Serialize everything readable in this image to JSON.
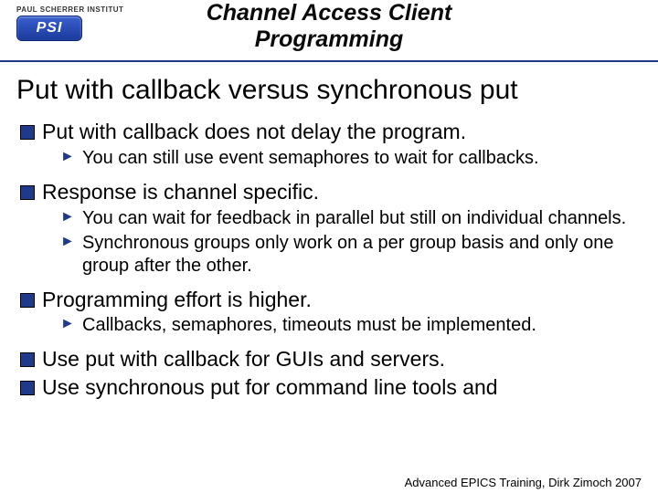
{
  "header": {
    "institute": "PAUL SCHERRER INSTITUT",
    "logo_text": "PSI",
    "title_line1": "Channel Access Client",
    "title_line2": "Programming"
  },
  "slide": {
    "title": "Put with callback versus synchronous put",
    "bullets": [
      {
        "text": "Put with callback does not delay the program.",
        "sub": [
          "You can still use event semaphores to wait for callbacks."
        ]
      },
      {
        "text": "Response is channel specific.",
        "sub": [
          "You can wait for feedback in parallel but still on individual channels.",
          "Synchronous groups only work on a per group basis and only one group after the other."
        ]
      },
      {
        "text": "Programming effort is higher.",
        "sub": [
          "Callbacks, semaphores, timeouts must be implemented."
        ]
      },
      {
        "text": "Use put with callback for GUIs and servers.",
        "sub": []
      },
      {
        "text": "Use synchronous put for command line tools and",
        "sub": []
      }
    ]
  },
  "footer": {
    "text": "Advanced EPICS Training, Dirk Zimoch 2007"
  }
}
